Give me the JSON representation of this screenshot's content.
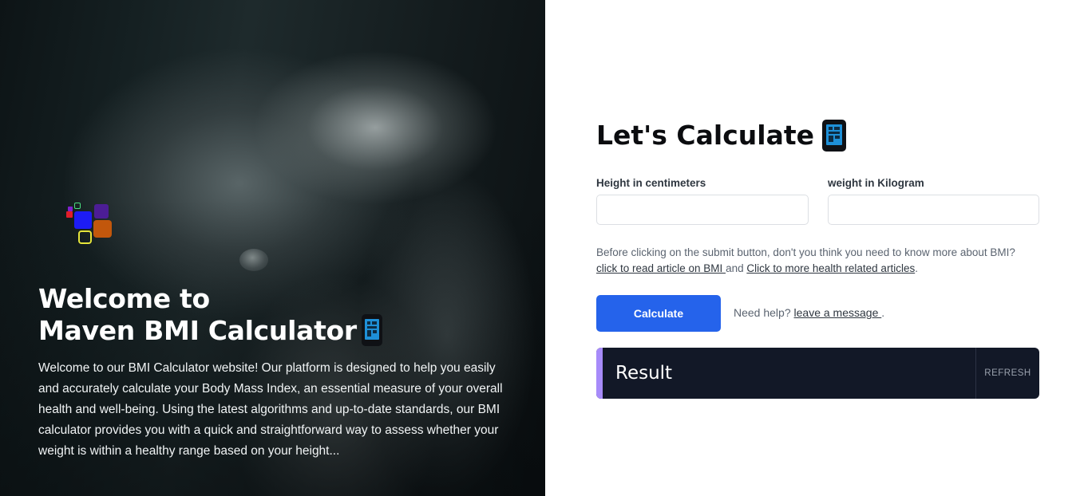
{
  "hero": {
    "title_line1": "Welcome to",
    "title_line2": "Maven BMI Calculator",
    "title_emoji": "mobile-phone",
    "description": "Welcome to our BMI Calculator website! Our platform is designed to help you easily and accurately calculate your Body Mass Index, an essential measure of your overall health and well-being. Using the latest algorithms and up-to-date standards, our BMI calculator provides you with a quick and straightforward way to assess whether your weight is within a healthy range based on your height...",
    "logo": "colored-squares-logo"
  },
  "form": {
    "title": "Let's Calculate",
    "title_emoji": "mobile-phone",
    "height_label": "Height in centimeters",
    "height_value": "",
    "weight_label": "weight in Kilogram",
    "weight_value": "",
    "info_text": "Before clicking on the submit button, don't you think you need to know more about BMI?",
    "bmi_article_link": "click to read article on BMI ",
    "info_and": "and",
    "health_articles_link": "Click to more health related articles",
    "info_end": ".",
    "calculate_label": "Calculate",
    "help_text": "Need help?",
    "help_link": "leave a message ",
    "help_end": "."
  },
  "result": {
    "title": "Result",
    "refresh_label": "REFRESH"
  },
  "colors": {
    "primary": "#2563eb",
    "result_bg": "#121827",
    "result_accent": "#a78bfa"
  }
}
